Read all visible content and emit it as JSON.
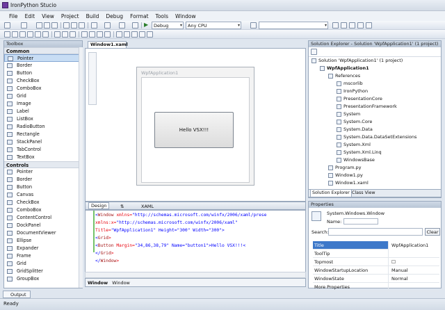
{
  "window": {
    "title": "IronPython Stucio"
  },
  "menu": [
    "File",
    "Edit",
    "View",
    "Project",
    "Build",
    "Debug",
    "Format",
    "Tools",
    "Window"
  ],
  "toolbar": {
    "config": "Debug",
    "platform": "Any CPU",
    "find": ""
  },
  "toolbox": {
    "title": "Toolbox",
    "groups": [
      {
        "label": "Common",
        "items": [
          "Pointer",
          "Border",
          "Button",
          "CheckBox",
          "ComboBox",
          "Grid",
          "Image",
          "Label",
          "ListBox",
          "RadioButton",
          "Rectangle",
          "StackPanel",
          "TabControl",
          "TextBox"
        ]
      },
      {
        "label": "Controls",
        "items": [
          "Pointer",
          "Border",
          "Button",
          "Canvas",
          "CheckBox",
          "ComboBox",
          "ContentControl",
          "DockPanel",
          "DocumentViewer",
          "Ellipse",
          "Expander",
          "Frame",
          "Grid",
          "GridSplitter",
          "GroupBox"
        ]
      }
    ]
  },
  "document": {
    "tab": "Window1.xaml",
    "wpf_title": "WpfApplication1",
    "button_text": "Hello VSX!!!",
    "view_tabs": {
      "design": "Design",
      "swap": "⇅",
      "xaml": "XAML"
    },
    "xaml_lines": [
      {
        "t": "<",
        "k": "Window",
        "a": " xmlns=",
        "v": "\"http://schemas.microsoft.com/winfx/2006/xaml/prese"
      },
      {
        "t": "",
        "k": "",
        "a": "  xmlns:x=",
        "v": "\"http://schemas.microsoft.com/winfx/2006/xaml\""
      },
      {
        "t": "",
        "k": "",
        "a": "  Title=",
        "v": "\"WpfApplication1\" Height=\"300\" Width=\"300\">"
      },
      {
        "t": "  <",
        "k": "Grid",
        "a": ">",
        "v": ""
      },
      {
        "t": "    <",
        "k": "Button",
        "a": " Margin=",
        "v": "\"34,86,38,79\" Name=\"button1\">Hello VSX!!!<"
      },
      {
        "t": "  </",
        "k": "Grid",
        "a": ">",
        "v": ""
      },
      {
        "t": "</",
        "k": "Window",
        "a": ">",
        "v": ""
      }
    ],
    "status_a": "Window",
    "status_b": "Window"
  },
  "solution": {
    "title": "Solution Explorer - Solution 'WpfApplication1' (1 project)",
    "nodes": [
      {
        "label": "Solution 'WpfApplication1' (1 project)",
        "indent": 0
      },
      {
        "label": "WpfApplication1",
        "indent": 1,
        "bold": true
      },
      {
        "label": "References",
        "indent": 2
      },
      {
        "label": "mscorlib",
        "indent": 3
      },
      {
        "label": "IronPython",
        "indent": 3
      },
      {
        "label": "PresentationCore",
        "indent": 3
      },
      {
        "label": "PresentationFramework",
        "indent": 3
      },
      {
        "label": "System",
        "indent": 3
      },
      {
        "label": "System.Core",
        "indent": 3
      },
      {
        "label": "System.Data",
        "indent": 3
      },
      {
        "label": "System.Data.DataSetExtensions",
        "indent": 3
      },
      {
        "label": "System.Xml",
        "indent": 3
      },
      {
        "label": "System.Xml.Linq",
        "indent": 3
      },
      {
        "label": "WindowsBase",
        "indent": 3
      },
      {
        "label": "Program.py",
        "indent": 2
      },
      {
        "label": "Window1.py",
        "indent": 2
      },
      {
        "label": "Window1.xaml",
        "indent": 2
      }
    ],
    "tab1": "Solution Explorer",
    "tab2": "Class View"
  },
  "properties": {
    "title": "Properties",
    "type": "System.Windows.Window",
    "name_label": "Name:",
    "search_label": "Search:",
    "clear": "Clear",
    "rows": [
      {
        "n": "Title",
        "v": "WpfApplication1",
        "sel": true
      },
      {
        "n": "ToolTip",
        "v": ""
      },
      {
        "n": "Topmost",
        "v": "☐"
      },
      {
        "n": "WindowStartupLocation",
        "v": "Manual"
      },
      {
        "n": "WindowState",
        "v": "Normal"
      },
      {
        "n": "More Properties",
        "v": ""
      }
    ]
  },
  "output_tab": "Output",
  "status": "Ready"
}
